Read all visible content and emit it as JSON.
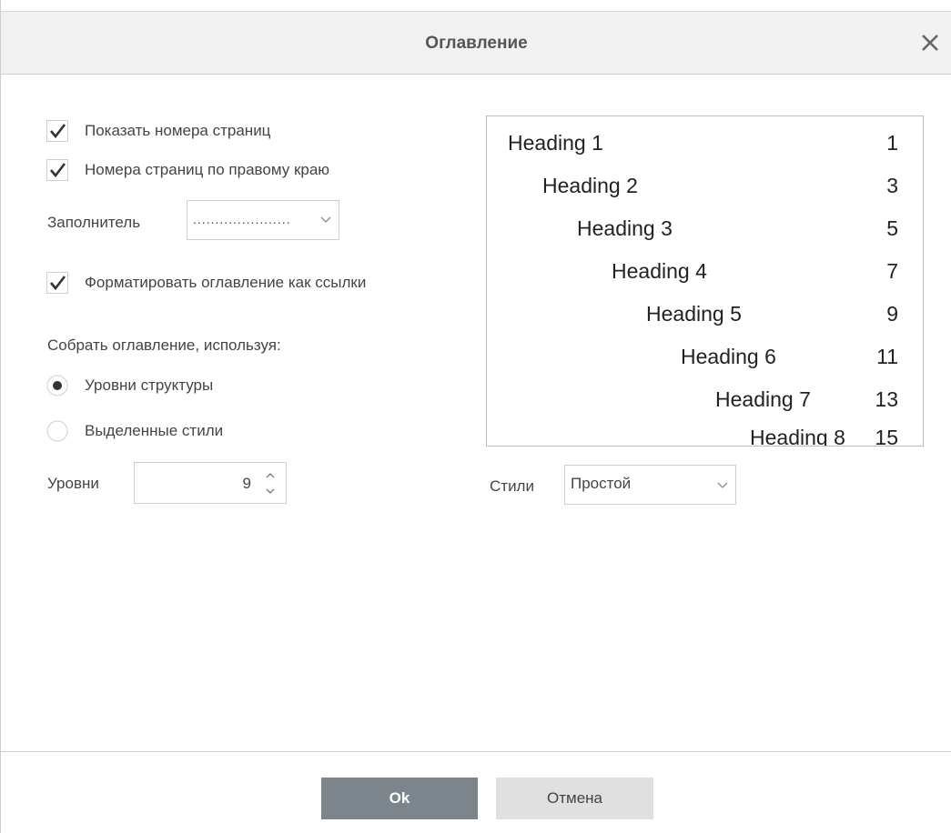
{
  "dialog": {
    "title": "Оглавление",
    "close_icon": "close-icon"
  },
  "options": {
    "show_page_numbers": {
      "label": "Показать номера страниц",
      "checked": true
    },
    "right_align_numbers": {
      "label": "Номера страниц по правому краю",
      "checked": true
    },
    "leader": {
      "label": "Заполнитель",
      "value": "......................"
    },
    "format_as_links": {
      "label": "Форматировать оглавление как ссылки",
      "checked": true
    },
    "build_from_label": "Собрать оглавление, используя:",
    "radio_levels": {
      "label": "Уровни структуры",
      "selected": true
    },
    "radio_styles": {
      "label": "Выделенные стили",
      "selected": false
    },
    "levels": {
      "label": "Уровни",
      "value": "9"
    }
  },
  "preview": {
    "rows": [
      {
        "heading": "Heading 1",
        "page": "1"
      },
      {
        "heading": "Heading 2",
        "page": "3"
      },
      {
        "heading": "Heading 3",
        "page": "5"
      },
      {
        "heading": "Heading 4",
        "page": "7"
      },
      {
        "heading": "Heading 5",
        "page": "9"
      },
      {
        "heading": "Heading 6",
        "page": "11"
      },
      {
        "heading": "Heading 7",
        "page": "13"
      },
      {
        "heading": "Heading 8",
        "page": "15"
      }
    ]
  },
  "styles": {
    "label": "Стили",
    "value": "Простой"
  },
  "buttons": {
    "ok": "Ok",
    "cancel": "Отмена"
  },
  "colors": {
    "ok_button": "#7d858c",
    "cancel_button": "#e0e0e0",
    "titlebar": "#f1f1f1"
  }
}
